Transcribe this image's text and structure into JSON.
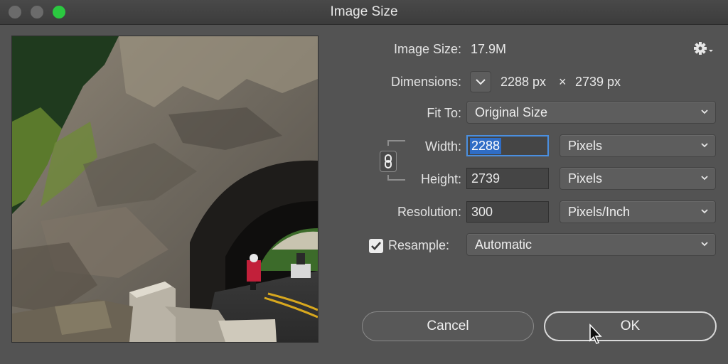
{
  "window": {
    "title": "Image Size"
  },
  "image_size": {
    "label": "Image Size:",
    "value": "17.9M"
  },
  "dimensions": {
    "label": "Dimensions:",
    "width": "2288 px",
    "separator": "×",
    "height": "2739 px"
  },
  "fit_to": {
    "label": "Fit To:",
    "value": "Original Size"
  },
  "width": {
    "label": "Width:",
    "value": "2288",
    "unit": "Pixels"
  },
  "height": {
    "label": "Height:",
    "value": "2739",
    "unit": "Pixels"
  },
  "resolution": {
    "label": "Resolution:",
    "value": "300",
    "unit": "Pixels/Inch"
  },
  "resample": {
    "label": "Resample:",
    "checked": true,
    "value": "Automatic"
  },
  "buttons": {
    "cancel": "Cancel",
    "ok": "OK"
  },
  "icons": {
    "settings": "gear-icon",
    "constrain": "chain-link-icon",
    "dropdown": "chevron-down-icon",
    "pointer": "mouse-cursor-icon"
  },
  "colors": {
    "dialog_bg": "#535353",
    "focus_ring": "#4a8fe0",
    "selection": "#2f6dc6",
    "zoom_button": "#2bc840"
  }
}
